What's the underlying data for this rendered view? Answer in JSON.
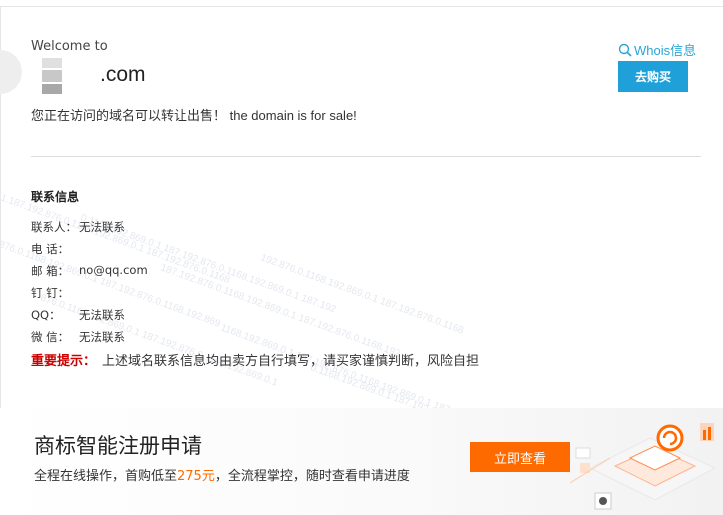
{
  "header": {
    "welcome": "Welcome to",
    "domain_suffix": ".com",
    "sale_notice": "您正在访问的域名可以转让出售！  the domain is for sale!",
    "whois_label": "Whois信息",
    "buy_label": "去购买"
  },
  "contact": {
    "title": "联系信息",
    "rows": [
      {
        "label": "联系人：",
        "value": "无法联系"
      },
      {
        "label": "电 话：",
        "value": ""
      },
      {
        "label": "邮 箱：",
        "value": "no@qq.com"
      },
      {
        "label": "钉 钉：",
        "value": ""
      },
      {
        "label": "QQ：",
        "value": "无法联系"
      },
      {
        "label": "微 信：",
        "value": "无法联系"
      }
    ],
    "notice_label": "重要提示：",
    "notice_text": "上述域名联系信息均由卖方自行填写，请买家谨慎判断，风险自担"
  },
  "banner": {
    "title": "商标智能注册申请",
    "sub_before": "全程在线操作，首购低至",
    "sub_price": "275元",
    "sub_after": "，全流程掌控，随时查看申请进度",
    "button_label": "立即查看"
  },
  "colors": {
    "accent": "#1fa0d8",
    "whois": "#2aa4d8",
    "notice": "#cc0000",
    "banner_button": "#ff6a00"
  },
  "icons": {
    "whois": "search-icon"
  }
}
